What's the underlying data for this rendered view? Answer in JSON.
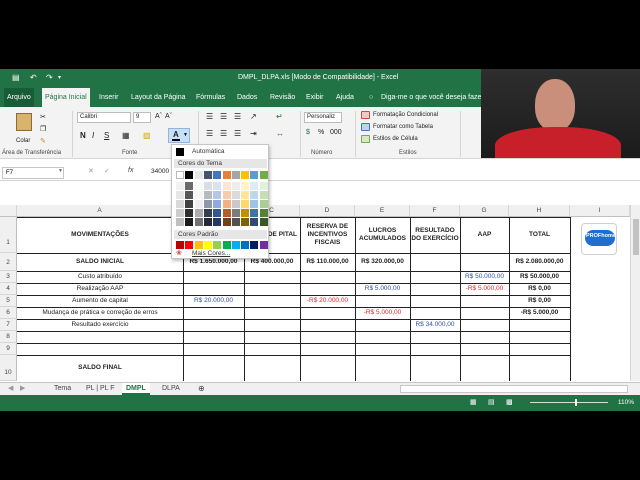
{
  "window": {
    "title": "DMPL_DLPA.xls  [Modo de Compatibilidade]  -  Excel"
  },
  "ribbon_tabs": [
    "Arquivo",
    "Página Inicial",
    "Inserir",
    "Layout da Página",
    "Fórmulas",
    "Dados",
    "Revisão",
    "Exibir",
    "Ajuda"
  ],
  "tell_me": "Diga-me o que você deseja fazer",
  "ribbon": {
    "clipboard_label": "Área de Transferência",
    "paste_label": "Colar",
    "font_label": "Fonte",
    "font_name": "Calibri",
    "font_size": "9",
    "number_label": "Número",
    "number_format": "Personaliz",
    "styles_label": "Estilos",
    "cond_format": "Formatação Condicional",
    "format_table": "Formatar como Tabela",
    "cell_styles": "Estilos de Célula",
    "bold": "N",
    "italic": "I",
    "underline": "S",
    "font_color_btn": "A"
  },
  "formula_bar": {
    "name_box": "F7",
    "fx": "fx",
    "value": "34000"
  },
  "color_picker": {
    "automatic": "Automática",
    "theme_colors": "Cores do Tema",
    "standard_colors": "Cores Padrão",
    "more_colors": "Mais Cores...",
    "theme_top": [
      "#ffffff",
      "#000000",
      "#e7e6e6",
      "#44546a",
      "#4472c4",
      "#ed7d31",
      "#a5a5a5",
      "#ffc000",
      "#5b9bd5",
      "#70ad47"
    ],
    "standard": [
      "#c00000",
      "#ff0000",
      "#ffc000",
      "#ffff00",
      "#92d050",
      "#00b050",
      "#00b0f0",
      "#0070c0",
      "#002060",
      "#7030a0"
    ]
  },
  "sheet": {
    "columns": [
      "A",
      "B",
      "C",
      "D",
      "E",
      "F",
      "G",
      "H",
      "I"
    ],
    "row_numbers": [
      "1",
      "2",
      "3",
      "4",
      "5",
      "6",
      "7",
      "8",
      "9",
      "10"
    ],
    "headers": {
      "A": "MOVIMENTAÇÕES",
      "C": "RVA DE PITAL",
      "D": "RESERVA DE INCENTIVOS FISCAIS",
      "E": "LUCROS ACUMULADOS",
      "F": "RESULTADO DO EXERCÍCIO",
      "G": "AAP",
      "H": "TOTAL"
    },
    "rows": {
      "r2": {
        "A": "SALDO INICIAL",
        "B": "R$ 1.650.000,00",
        "C": "R$ 400.000,00",
        "D": "R$ 110.000,00",
        "E": "R$ 320.000,00",
        "H": "R$ 2.080.000,00"
      },
      "r3": {
        "A": "Custo atribuído",
        "G": "R$ 50.000,00",
        "H": "R$ 50.000,00"
      },
      "r4": {
        "A": "Realização AAP",
        "E": "R$ 5.000,00",
        "G": "-R$ 5.000,00",
        "H": "R$ 0,00"
      },
      "r5": {
        "A": "Aumento de capital",
        "B": "R$ 20.000,00",
        "D": "-R$ 20.000,00",
        "H": "R$ 0,00"
      },
      "r6": {
        "A": "Mudança de prática e correção de erros",
        "E": "-R$ 5.000,00",
        "H": "-R$ 5.000,00"
      },
      "r7": {
        "A": "Resultado exercício",
        "F": "R$ 34.000,00"
      },
      "r10": {
        "A": "SALDO FINAL"
      }
    },
    "logo_text": "PROFhome"
  },
  "sheet_tabs": [
    "Tema",
    "PL | PL F",
    "DMPL",
    "DLPA"
  ],
  "active_sheet": "DMPL",
  "zoom": "110%",
  "colors": {
    "excel_green": "#217346",
    "red_text": "#e0272f"
  }
}
